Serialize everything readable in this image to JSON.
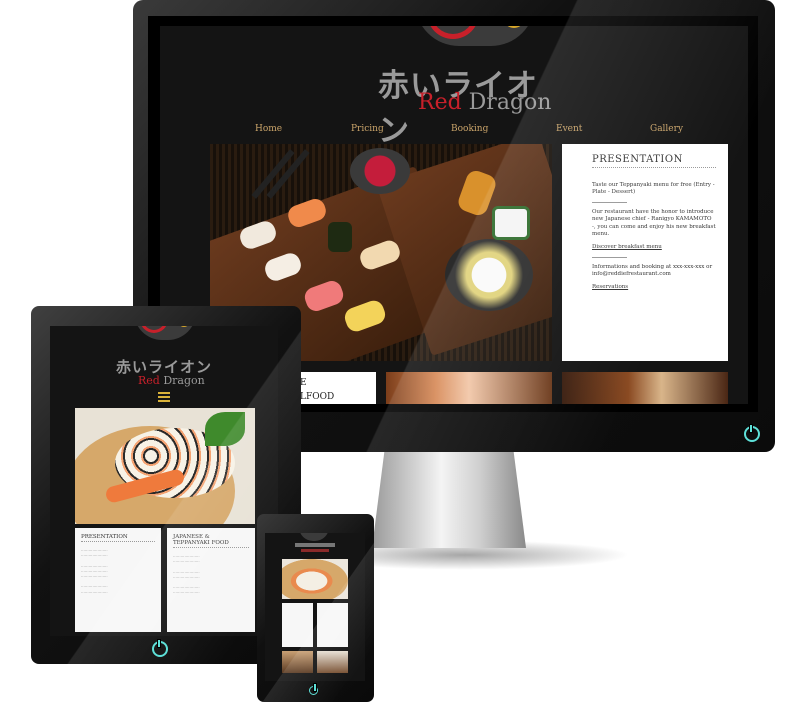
{
  "site": {
    "logo_jp": "赤いライオン",
    "logo_en_red": "Red",
    "logo_en_gray": "Dragon"
  },
  "nav": [
    "Home",
    "Pricing",
    "Booking",
    "Event",
    "Gallery"
  ],
  "presentation": {
    "title": "PRESENTATION",
    "p1": "Taste our Teppanyaki menu for free (Entry - Plate - Dessert)",
    "p2": "Our restaurant have the honor to introduce new Japanese chief - Ranigyo KAMAMOTO -, you can come and enjoy his new breakfast menu.",
    "link1": "Discover breakfast menu",
    "p3": "Informations and booking at xxx-xxx-xxx or info@reddiefrestaurant.com",
    "link2": "Reservations"
  },
  "teaser_fragment": {
    "line1": "E",
    "line2": "LFOOD"
  },
  "tablet": {
    "col1_title": "PRESENTATION",
    "col2_title_l1": "JAPANESE &",
    "col2_title_l2": "TEPPANYAKI FOOD"
  },
  "colors": {
    "accent_red": "#c8202a",
    "nav_gold": "#caa46a",
    "power_cyan": "#5ee0d8"
  }
}
